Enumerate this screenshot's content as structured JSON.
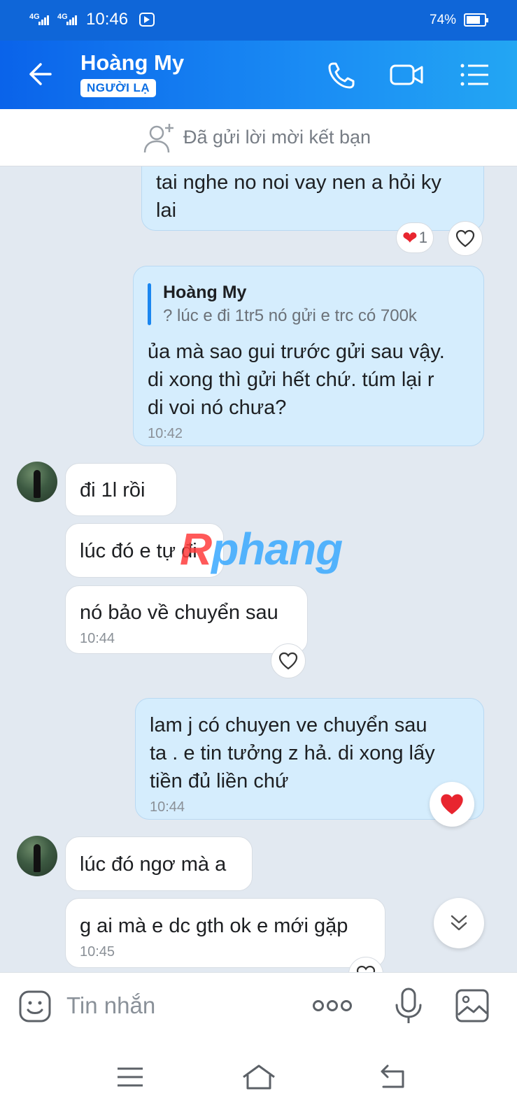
{
  "status_bar": {
    "signal1": "4G",
    "signal2": "4G",
    "time": "10:46",
    "battery_percent": "74%",
    "battery_level": 0.74
  },
  "header": {
    "contact_name": "Hoàng My",
    "badge": "NGƯỜI LẠ"
  },
  "friend_bar": {
    "text": "Đã gửi lời mời kết bạn"
  },
  "messages": [
    {
      "dir": "out",
      "lines": [
        "tai nghe no noi vay nen a hỏi ky",
        "lai"
      ],
      "reaction": {
        "emoji": "❤",
        "count": "1"
      }
    },
    {
      "dir": "out",
      "quote": {
        "name": "Hoàng My",
        "text": "? lúc e đi 1tr5 nó gửi e trc có 700k"
      },
      "lines": [
        "ủa mà sao gui trước gửi sau vậy.",
        "di xong thì gửi hết chứ. túm lại r",
        "di voi nó chưa?"
      ],
      "time": "10:42"
    },
    {
      "dir": "in",
      "lines": [
        "đi 1l rồi"
      ]
    },
    {
      "dir": "in",
      "lines": [
        "lúc đó e tự đi"
      ]
    },
    {
      "dir": "in",
      "lines": [
        "nó bảo về chuyển sau"
      ],
      "time": "10:44"
    },
    {
      "dir": "out",
      "lines": [
        "lam j có chuyen ve chuyển sau",
        "ta  . e tin tưởng z hả. di xong lấy",
        "tiền đủ liền chứ"
      ],
      "time": "10:44"
    },
    {
      "dir": "in",
      "lines": [
        "lúc đó ngơ mà a"
      ]
    },
    {
      "dir": "in",
      "lines": [
        "g ai mà e dc gth ok e mới gặp"
      ],
      "time": "10:45"
    }
  ],
  "watermark": {
    "part1": "R",
    "part2": "phang"
  },
  "input_bar": {
    "placeholder": "Tin nhắn"
  },
  "colors": {
    "header_blue": "#0a63ea",
    "outgoing_bubble": "#d5edfd",
    "incoming_bubble": "#ffffff",
    "heart_red": "#e8252f"
  }
}
